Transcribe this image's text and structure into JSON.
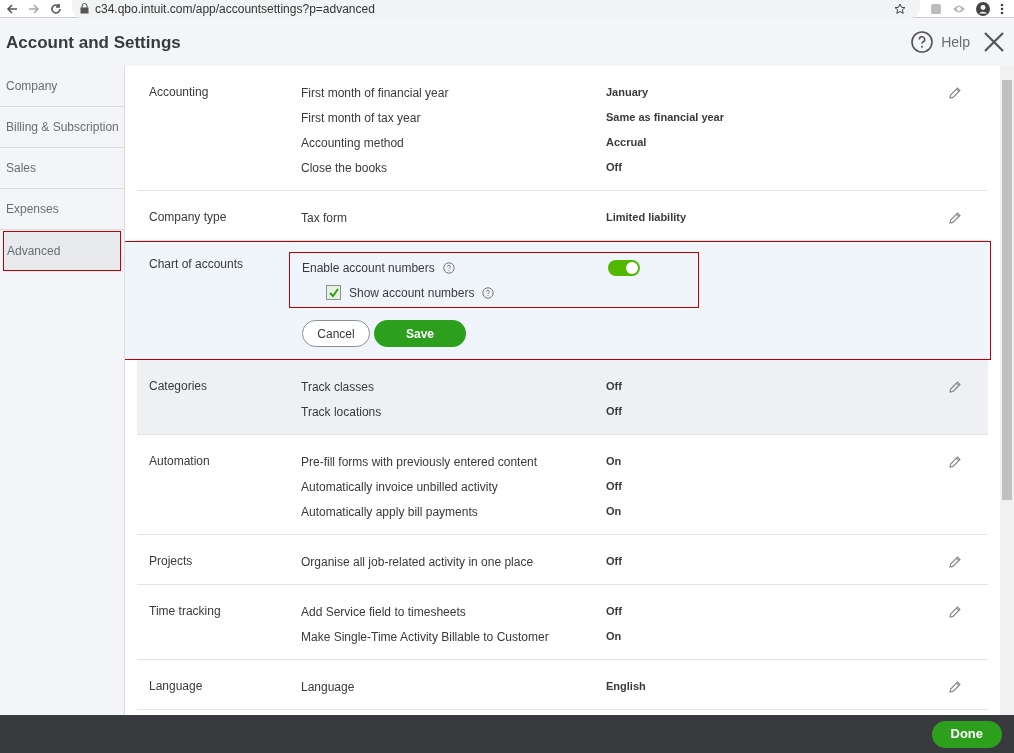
{
  "browser": {
    "url": "c34.qbo.intuit.com/app/accountsettings?p=advanced"
  },
  "header": {
    "title": "Account and Settings",
    "help": "Help"
  },
  "sidebar": {
    "items": [
      {
        "label": "Company",
        "selected": false
      },
      {
        "label": "Billing & Subscription",
        "selected": false
      },
      {
        "label": "Sales",
        "selected": false
      },
      {
        "label": "Expenses",
        "selected": false
      },
      {
        "label": "Advanced",
        "selected": true
      }
    ]
  },
  "sections": [
    {
      "label": "Accounting",
      "kind": "view",
      "hovered": false,
      "rows": [
        {
          "setting": "First month of financial year",
          "value": "January"
        },
        {
          "setting": "First month of tax year",
          "value": "Same as financial year"
        },
        {
          "setting": "Accounting method",
          "value": "Accrual"
        },
        {
          "setting": "Close the books",
          "value": "Off"
        }
      ]
    },
    {
      "label": "Company type",
      "kind": "view",
      "hovered": false,
      "rows": [
        {
          "setting": "Tax form",
          "value": "Limited liability"
        }
      ]
    },
    {
      "label": "Chart of accounts",
      "kind": "edit",
      "hovered": false,
      "rows": [
        {
          "kind": "toggle",
          "setting": "Enable account numbers",
          "on": true
        },
        {
          "kind": "checkbox",
          "setting": "Show account numbers",
          "checked": true
        }
      ],
      "buttons": [
        "Cancel",
        "Save"
      ]
    },
    {
      "label": "Categories",
      "kind": "view",
      "hovered": true,
      "rows": [
        {
          "setting": "Track classes",
          "value": "Off"
        },
        {
          "setting": "Track locations",
          "value": "Off"
        }
      ]
    },
    {
      "label": "Automation",
      "kind": "view",
      "hovered": false,
      "rows": [
        {
          "setting": "Pre-fill forms with previously entered content",
          "value": "On"
        },
        {
          "setting": "Automatically invoice unbilled activity",
          "value": "Off"
        },
        {
          "setting": "Automatically apply bill payments",
          "value": "On"
        }
      ]
    },
    {
      "label": "Projects",
      "kind": "view",
      "hovered": false,
      "rows": [
        {
          "setting": "Organise all job-related activity in one place",
          "value": "Off"
        }
      ]
    },
    {
      "label": "Time tracking",
      "kind": "view",
      "hovered": false,
      "rows": [
        {
          "setting": "Add Service field to timesheets",
          "value": "Off"
        },
        {
          "setting": "Make Single-Time Activity Billable to Customer",
          "value": "On"
        }
      ]
    },
    {
      "label": "Language",
      "kind": "view",
      "hovered": false,
      "rows": [
        {
          "setting": "Language",
          "value": "English"
        }
      ]
    }
  ],
  "footer": {
    "button": "Done"
  }
}
